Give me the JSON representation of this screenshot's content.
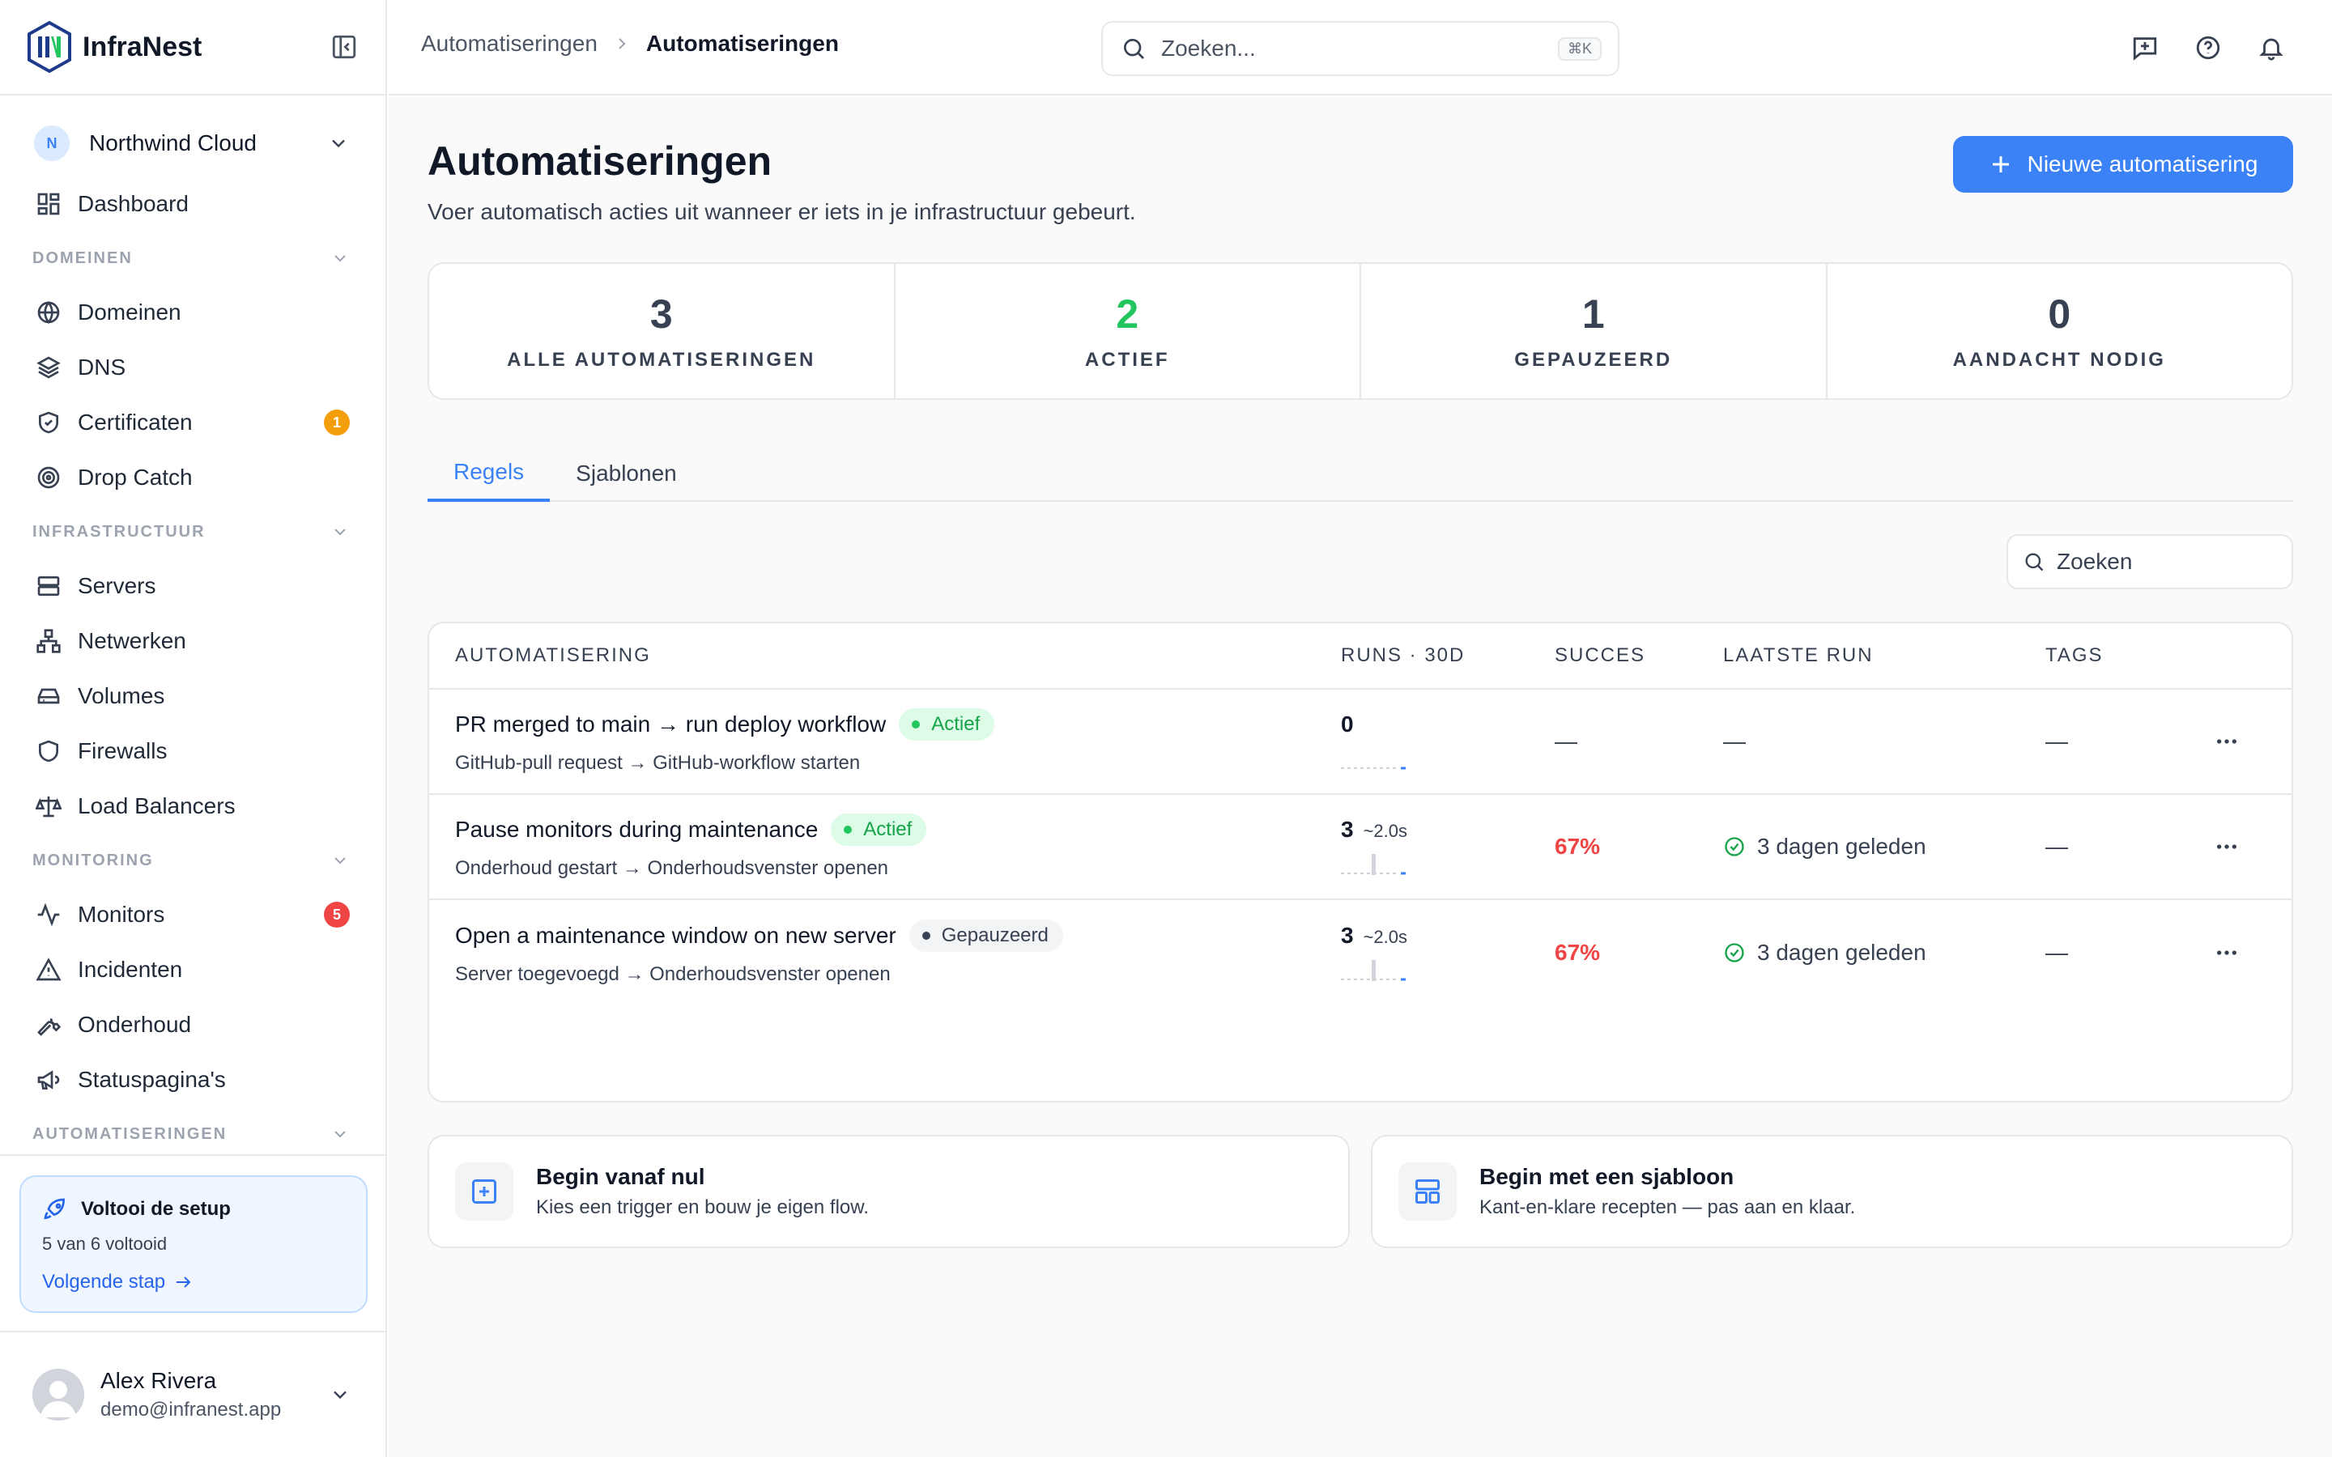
{
  "app": {
    "name": "InfraNest"
  },
  "org": {
    "initial": "N",
    "name": "Northwind Cloud"
  },
  "nav": {
    "dashboard": "Dashboard",
    "sections": {
      "domains": "DOMEINEN",
      "infra": "INFRASTRUCTUUR",
      "monitoring": "MONITORING",
      "automations": "AUTOMATISERINGEN"
    },
    "domains_items": [
      {
        "label": "Domeinen",
        "icon": "globe-icon"
      },
      {
        "label": "DNS",
        "icon": "layers-icon"
      },
      {
        "label": "Certificaten",
        "icon": "shield-check-icon",
        "badge": "1"
      },
      {
        "label": "Drop Catch",
        "icon": "target-icon"
      }
    ],
    "infra_items": [
      {
        "label": "Servers",
        "icon": "server-icon"
      },
      {
        "label": "Netwerken",
        "icon": "network-icon"
      },
      {
        "label": "Volumes",
        "icon": "drive-icon"
      },
      {
        "label": "Firewalls",
        "icon": "shield-icon"
      },
      {
        "label": "Load Balancers",
        "icon": "scale-icon"
      }
    ],
    "monitoring_items": [
      {
        "label": "Monitors",
        "icon": "activity-icon",
        "badge": "5"
      },
      {
        "label": "Incidenten",
        "icon": "alert-triangle-icon"
      },
      {
        "label": "Onderhoud",
        "icon": "wrench-icon"
      },
      {
        "label": "Statuspagina's",
        "icon": "megaphone-icon"
      }
    ],
    "badge_colors": {
      "warning": "#f59e0b",
      "danger": "#ef4444"
    }
  },
  "setup": {
    "title": "Voltooi de setup",
    "progress": "5 van 6 voltooid",
    "link": "Volgende stap"
  },
  "user": {
    "name": "Alex Rivera",
    "email": "demo@infranest.app"
  },
  "topbar": {
    "crumb_parent": "Automatiseringen",
    "crumb_current": "Automatiseringen",
    "search_placeholder": "Zoeken...",
    "shortcut": "⌘K"
  },
  "page": {
    "title": "Automatiseringen",
    "subtitle": "Voer automatisch acties uit wanneer er iets in je infrastructuur gebeurt.",
    "new_button": "Nieuwe automatisering",
    "accent": "#3b82f6"
  },
  "stats": [
    {
      "value": "3",
      "label": "ALLE AUTOMATISERINGEN",
      "color": "#374151"
    },
    {
      "value": "2",
      "label": "ACTIEF",
      "color": "#22c55e"
    },
    {
      "value": "1",
      "label": "GEPAUZEERD",
      "color": "#374151"
    },
    {
      "value": "0",
      "label": "AANDACHT NODIG",
      "color": "#374151"
    }
  ],
  "tabs": [
    "Regels",
    "Sjablonen"
  ],
  "table": {
    "search_placeholder": "Zoeken",
    "headers": {
      "automation": "AUTOMATISERING",
      "runs": "RUNS · 30D",
      "success": "SUCCES",
      "last_run": "LAATSTE RUN",
      "tags": "TAGS"
    },
    "rows": [
      {
        "title": "PR merged to main → run deploy workflow",
        "status": "Actief",
        "subtitle": "GitHub-pull request → GitHub-workflow starten",
        "runs": "0",
        "avg": "",
        "success": "—",
        "last_run": "—",
        "tags": "—"
      },
      {
        "title": "Pause monitors during maintenance",
        "status": "Actief",
        "subtitle": "Onderhoud gestart → Onderhoudsvenster openen",
        "runs": "3",
        "avg": "~2.0s",
        "success": "67%",
        "last_run": "3 dagen geleden",
        "tags": "—"
      },
      {
        "title": "Open a maintenance window on new server",
        "status": "Gepauzeerd",
        "subtitle": "Server toegevoegd → Onderhoudsvenster openen",
        "runs": "3",
        "avg": "~2.0s",
        "success": "67%",
        "last_run": "3 dagen geleden",
        "tags": "—"
      }
    ]
  },
  "cards": [
    {
      "title": "Begin vanaf nul",
      "subtitle": "Kies een trigger en bouw je eigen flow.",
      "icon": "plus-square-icon"
    },
    {
      "title": "Begin met een sjabloon",
      "subtitle": "Kant-en-klare recepten — pas aan en klaar.",
      "icon": "template-icon"
    }
  ]
}
